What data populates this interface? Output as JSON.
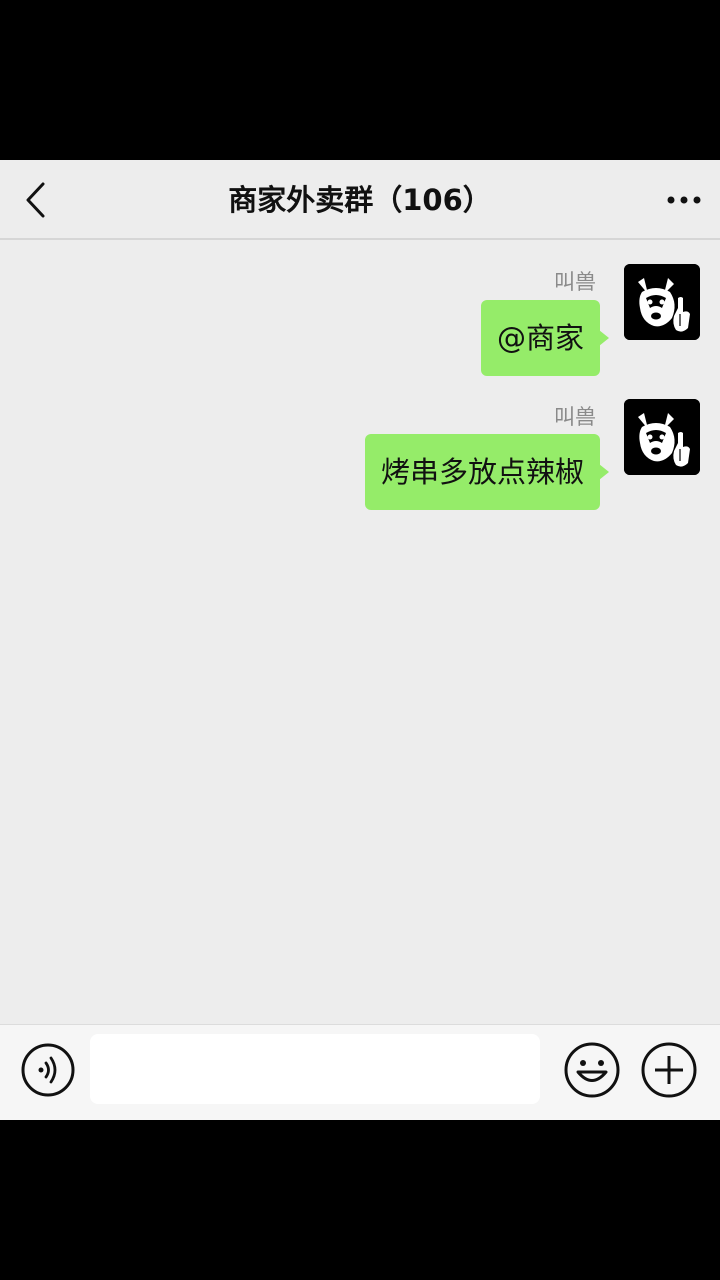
{
  "header": {
    "title": "商家外卖群（106）",
    "back_icon": "chevron-left-icon",
    "more_icon": "more-horizontal-icon"
  },
  "messages": [
    {
      "sender": "叫兽",
      "text": "@商家",
      "avatar": "husky-avatar"
    },
    {
      "sender": "叫兽",
      "text": "烤串多放点辣椒",
      "avatar": "husky-avatar"
    }
  ],
  "input_bar": {
    "voice_icon": "voice-icon",
    "input_value": "",
    "emoji_icon": "emoji-icon",
    "plus_icon": "plus-icon"
  },
  "colors": {
    "background": "#ededed",
    "bubble_self": "#95ec69",
    "sender_name": "#8a8a8a"
  }
}
